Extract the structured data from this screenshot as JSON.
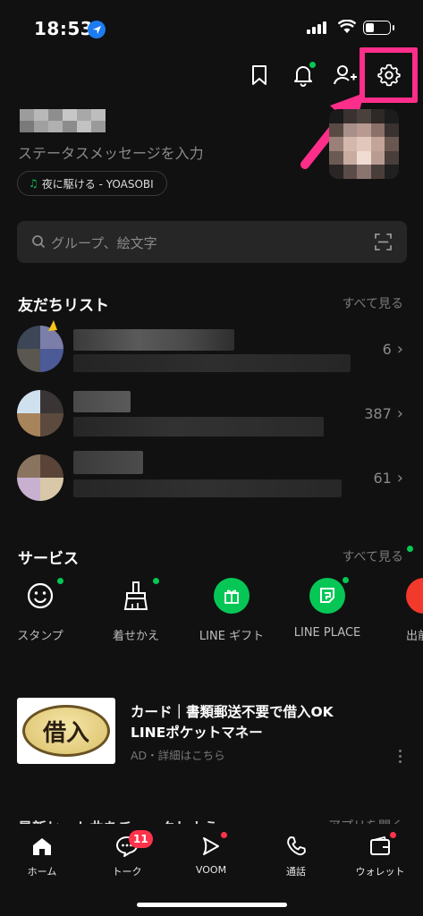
{
  "status_bar": {
    "time": "18:53"
  },
  "profile": {
    "status_message": "ステータスメッセージを入力",
    "music": "夜に駆ける - YOASOBI"
  },
  "search": {
    "placeholder": "グループ、絵文字"
  },
  "friends": {
    "title": "友だちリスト",
    "see_all": "すべて見る",
    "groups": [
      {
        "count": "6"
      },
      {
        "count": "387"
      },
      {
        "count": "61"
      }
    ]
  },
  "services": {
    "title": "サービス",
    "see_all": "すべて見る",
    "items": [
      {
        "label": "スタンプ",
        "icon": "smile-icon"
      },
      {
        "label": "着せかえ",
        "icon": "brush-icon"
      },
      {
        "label": "LINE ギフト",
        "icon": "gift-icon"
      },
      {
        "label": "LINE PLACE",
        "icon": "place-icon"
      },
      {
        "label": "出前",
        "icon": "delivery-icon"
      }
    ]
  },
  "ad": {
    "image_text": "借入",
    "title": "カード｜書類郵送不要で借入OK LINEポケットマネー",
    "sub": "AD・詳細はこちら"
  },
  "next_section": {
    "title": "最新ヒット曲をチェックしよう",
    "link": "アプリを開く"
  },
  "tabs": [
    {
      "label": "ホーム",
      "icon": "home-icon"
    },
    {
      "label": "トーク",
      "icon": "chat-icon",
      "badge": "11"
    },
    {
      "label": "VOOM",
      "icon": "voom-icon"
    },
    {
      "label": "通話",
      "icon": "phone-icon"
    },
    {
      "label": "ウォレット",
      "icon": "wallet-icon"
    }
  ],
  "colors": {
    "accent_green": "#06c755",
    "highlight_pink": "#ff2e8a",
    "badge_red": "#ff334b"
  }
}
